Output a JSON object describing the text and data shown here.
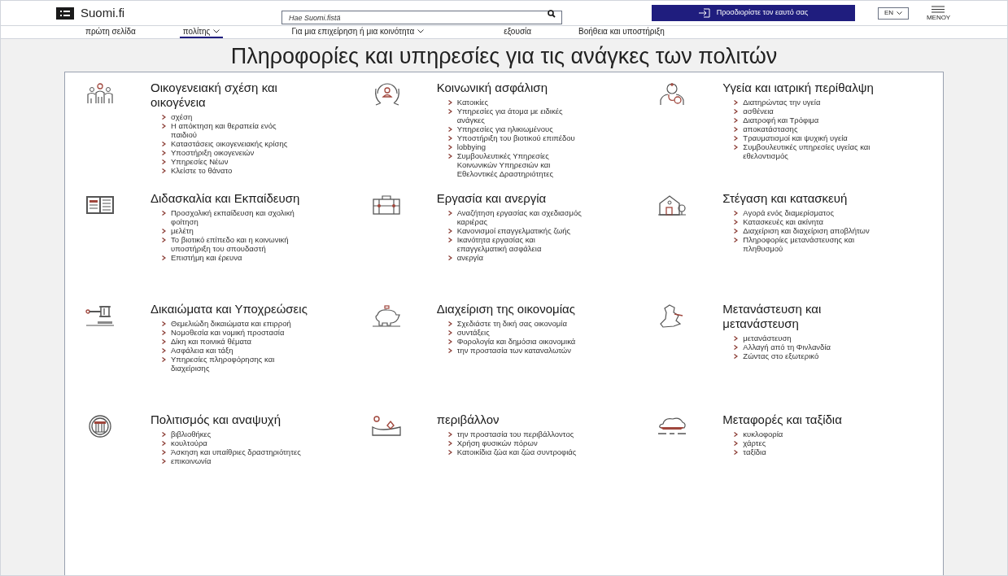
{
  "header": {
    "logo_text": "Suomi.fi",
    "search": {
      "placeholder": "Hae Suomi.fistä"
    },
    "login_button": "Προσδιορίστε τον εαυτό σας",
    "language": "EN",
    "menu_label": "ΜΕΝΟΥ"
  },
  "nav": [
    {
      "label": "πρώτη σελίδα",
      "dropdown": false,
      "selected": false
    },
    {
      "label": "πολίτης",
      "dropdown": true,
      "selected": true
    },
    {
      "label": "Για μια επιχείρηση ή μια κοινότητα",
      "dropdown": true,
      "selected": false
    },
    {
      "label": "εξουσία",
      "dropdown": false,
      "selected": false
    },
    {
      "label": "Βοήθεια και υποστήριξη",
      "dropdown": false,
      "selected": false
    }
  ],
  "heading": "Πληροφορίες και υπηρεσίες για τις ανάγκες των πολιτών",
  "categories": [
    {
      "title": "Οικογενειακή σχέση και οικογένεια",
      "links": [
        "σχέση",
        "Η απόκτηση και θεραπεία ενός παιδιού",
        "Καταστάσεις οικογενειακής κρίσης",
        "Υποστήριξη οικογενειών",
        "Υπηρεσίες Νέων",
        "Κλείστε το θάνατο"
      ]
    },
    {
      "title": "Κοινωνική ασφάλιση",
      "links": [
        "Κατοικίες",
        "Υπηρεσίες για άτομα με ειδικές ανάγκες",
        "Υπηρεσίες για ηλικιωμένους",
        "Υποστήριξη του βιοτικού επιπέδου",
        "lobbying",
        "Συμβουλευτικές Υπηρεσίες Κοινωνικών Υπηρεσιών και Εθελοντικές Δραστηριότητες"
      ]
    },
    {
      "title": "Υγεία και ιατρική περίθαλψη",
      "links": [
        "Διατηρώντας την υγεία",
        "ασθένεια",
        "Διατροφή και Τρόφιμα",
        "αποκατάστασης",
        "Τραυματισμοί και ψυχική υγεία",
        "Συμβουλευτικές υπηρεσίες υγείας και εθελοντισμός"
      ]
    },
    {
      "title": "Διδασκαλία και Εκπαίδευση",
      "links": [
        "Προσχολική εκπαίδευση και σχολική φοίτηση",
        "μελέτη",
        "Το βιοτικό επίπεδο και η κοινωνική υποστήριξη του σπουδαστή",
        "Επιστήμη και έρευνα"
      ]
    },
    {
      "title": "Εργασία και ανεργία",
      "links": [
        "Αναζήτηση εργασίας και σχεδιασμός καριέρας",
        "Κανονισμοί επαγγελματικής ζωής",
        "Ικανότητα εργασίας και επαγγελματική ασφάλεια",
        "ανεργία"
      ]
    },
    {
      "title": "Στέγαση και κατασκευή",
      "links": [
        "Αγορά ενός διαμερίσματος",
        "Κατασκευές και ακίνητα",
        "Διαχείριση και διαχείριση αποβλήτων",
        "Πληροφορίες μετανάστευσης και πληθυσμού"
      ]
    },
    {
      "title": "Δικαιώματα και Υποχρεώσεις",
      "links": [
        "Θεμελιώδη δικαιώματα και επιρροή",
        "Νομοθεσία και νομική προστασία",
        "Δίκη και ποινικά θέματα",
        "Ασφάλεια και τάξη",
        "Υπηρεσίες πληροφόρησης και διαχείρισης"
      ]
    },
    {
      "title": "Διαχείριση της οικονομίας",
      "links": [
        "Σχεδιάστε τη δική σας οικονομία",
        "συντάξεις",
        "Φορολογία και δημόσια οικονομικά",
        "την προστασία των καταναλωτών"
      ]
    },
    {
      "title": "Μετανάστευση και μετανάστευση",
      "links": [
        "μετανάστευση",
        "Αλλαγή από τη Φινλανδία",
        "Ζώντας στο εξωτερικό"
      ]
    },
    {
      "title": "Πολιτισμός και αναψυχή",
      "links": [
        "βιβλιοθήκες",
        "κουλτούρα",
        "Άσκηση και υπαίθριες δραστηριότητες",
        "επικοινωνία"
      ]
    },
    {
      "title": "περιβάλλον",
      "links": [
        "την προστασία του περιβάλλοντος",
        "Χρήση φυσικών πόρων",
        "Κατοικίδια ζώα και ζώα συντροφιάς"
      ]
    },
    {
      "title": "Μεταφορές και ταξίδια",
      "links": [
        "κυκλοφορία",
        "χάρτες",
        "ταξίδια"
      ]
    }
  ]
}
